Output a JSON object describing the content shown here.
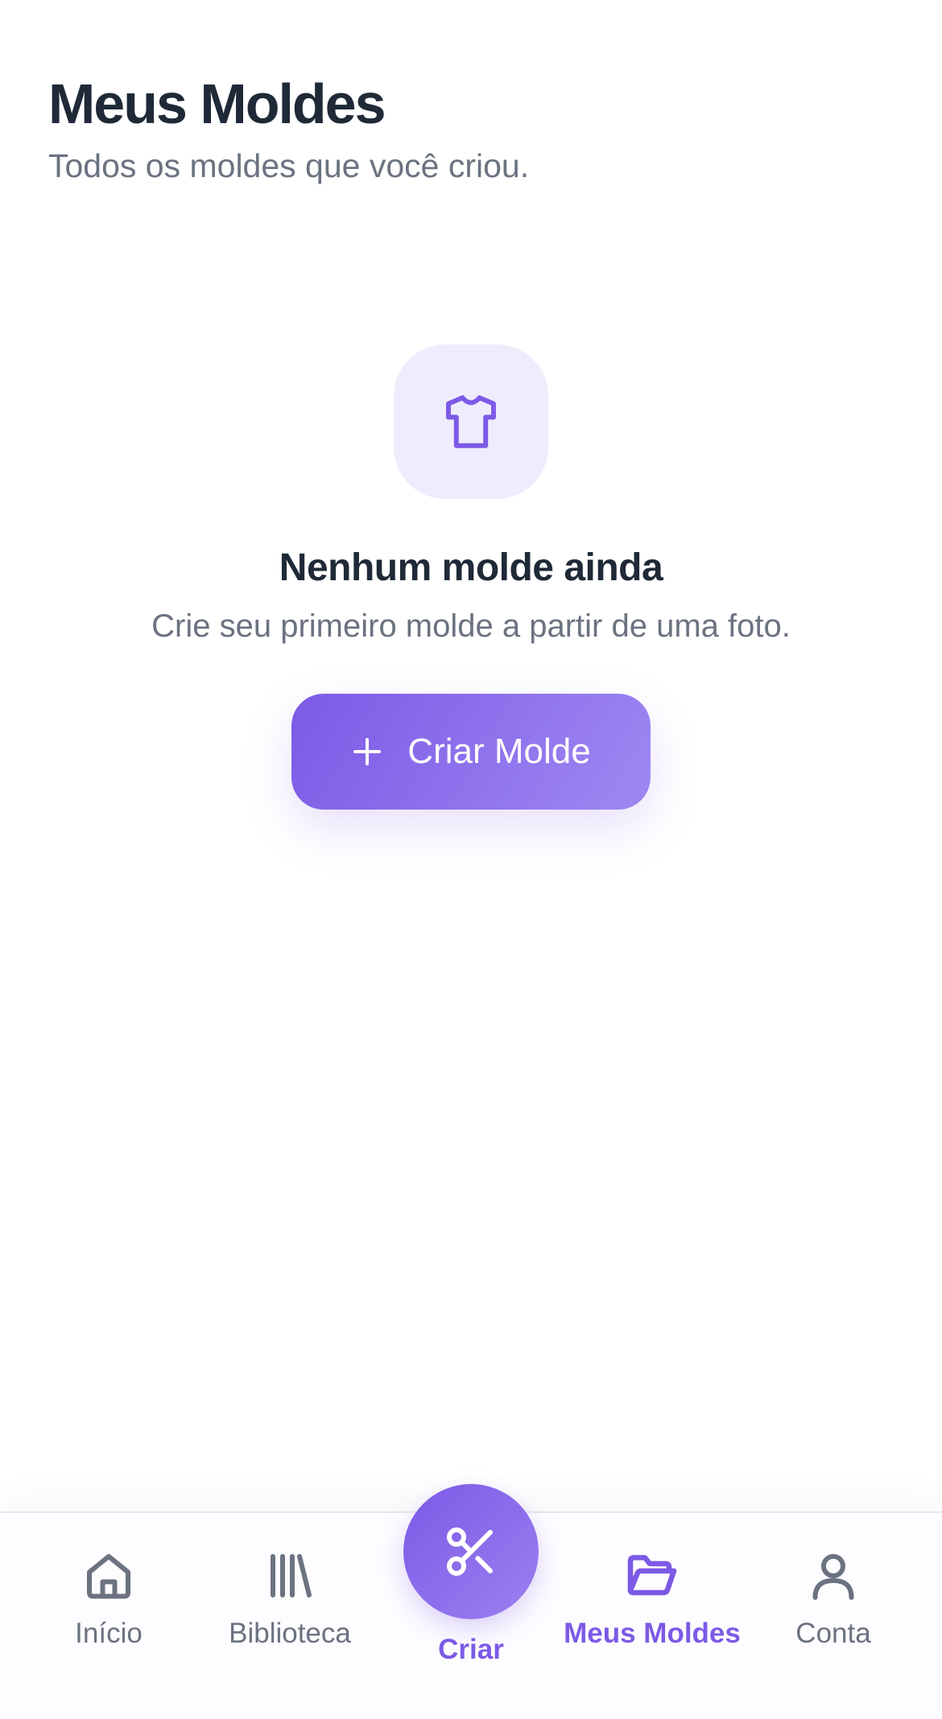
{
  "header": {
    "title": "Meus Moldes",
    "subtitle": "Todos os moldes que você criou."
  },
  "empty_state": {
    "icon": "shirt-icon",
    "title": "Nenhum molde ainda",
    "description": "Crie seu primeiro molde a partir de uma foto.",
    "button_label": "Criar Molde",
    "button_icon": "plus-icon"
  },
  "bottom_nav": {
    "items": [
      {
        "label": "Início",
        "icon": "home-icon",
        "active": false
      },
      {
        "label": "Biblioteca",
        "icon": "library-icon",
        "active": false
      },
      {
        "label": "Criar",
        "icon": "scissors-icon",
        "active": false
      },
      {
        "label": "Meus Moldes",
        "icon": "folder-open-icon",
        "active": true
      },
      {
        "label": "Conta",
        "icon": "user-icon",
        "active": false
      }
    ]
  },
  "colors": {
    "accent": "#7c5ae6",
    "accent_light": "#efecfd",
    "text_primary": "#1f2937",
    "text_secondary": "#6b7280"
  }
}
